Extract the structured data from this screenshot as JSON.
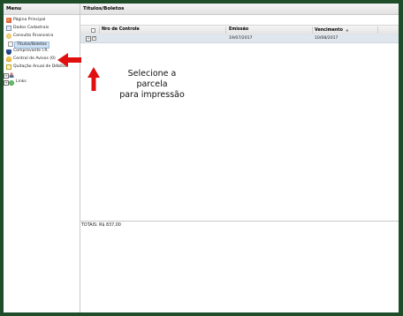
{
  "menu": {
    "title": "Menu",
    "items": [
      {
        "label": "Página Principal",
        "icon": "home-icon"
      },
      {
        "label": "Dados Cadastrais",
        "icon": "document-icon"
      },
      {
        "label": "Consulta Financeira",
        "icon": "money-icon"
      },
      {
        "label": "Títulos/Boletos",
        "icon": "page-icon",
        "selected": true
      },
      {
        "label": "Comprovante I.R.",
        "icon": "shield-icon"
      },
      {
        "label": "Central de Avisos (0)",
        "icon": "bell-icon"
      },
      {
        "label": "Quitação Anual de Débitos",
        "icon": "invoice-icon"
      },
      {
        "label": "",
        "icon": "user-icon"
      },
      {
        "label": "Links",
        "icon": "links-icon"
      }
    ]
  },
  "content": {
    "title": "Títulos/Boletos",
    "columns": [
      "Nro de Controle",
      "Emissão",
      "Vencimento"
    ],
    "sort_indicator": "▲",
    "rows": [
      {
        "expand": "+",
        "checked": "✓",
        "nro_controle": "",
        "emissao": "19/07/2017",
        "vencimento": "10/08/2017"
      }
    ],
    "totals": "TOTAIS: R$ 837,00"
  },
  "annotation": {
    "line1": "Selecione a parcela",
    "line2": "para impressão",
    "color": "#e01010"
  }
}
